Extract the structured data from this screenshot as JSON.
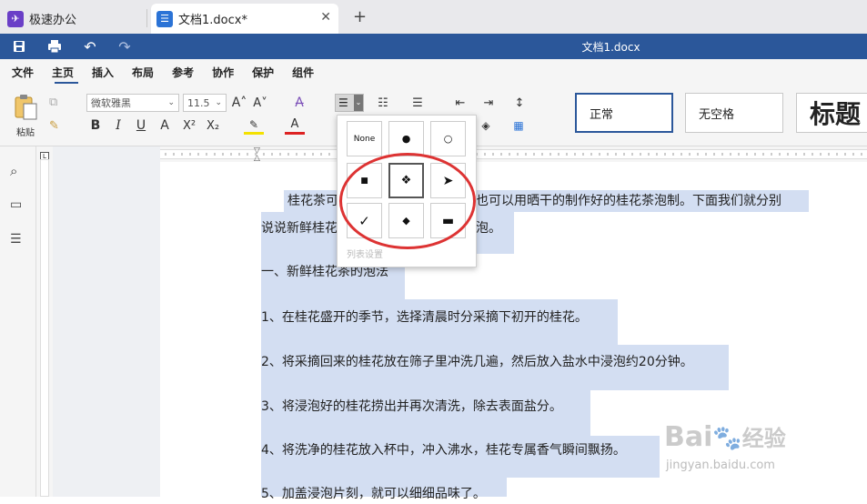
{
  "tabs": [
    {
      "label": "极速办公",
      "icon": "app-logo-icon"
    },
    {
      "label": "文档1.docx*",
      "icon": "document-icon"
    }
  ],
  "window": {
    "title": "文档1.docx"
  },
  "menu": [
    "文件",
    "主页",
    "插入",
    "布局",
    "参考",
    "协作",
    "保护",
    "组件"
  ],
  "ribbon": {
    "paste_label": "粘贴",
    "font_name": "微软雅黑",
    "font_size": "11.5",
    "bold": "B",
    "italic": "I",
    "underline": "U",
    "strike": "A",
    "superscript": "X²",
    "subscript": "X₂",
    "grow": "A˄",
    "shrink": "A˅"
  },
  "styles": [
    {
      "label": "正常"
    },
    {
      "label": "无空格"
    },
    {
      "label": "标题"
    }
  ],
  "bullet_popup": {
    "none_label": "None",
    "bullets": [
      "●",
      "○",
      "■",
      "❖",
      "➤",
      "✓",
      "◆",
      "▬"
    ],
    "settings_label": "列表设置"
  },
  "document": {
    "lines": [
      "桂花茶可",
      "也可以用晒干的制作好的桂花茶泡制。下面我们就分别",
      "说说新鲜桂花",
      "泡。",
      "一、新鲜桂花茶的泡法",
      "1、在桂花盛开的季节，选择清晨时分采摘下初开的桂花。",
      "2、将采摘回来的桂花放在筛子里冲洗几遍，然后放入盐水中浸泡约20分钟。",
      "3、将浸泡好的桂花捞出并再次清洗，除去表面盐分。",
      "4、将洗净的桂花放入杯中，冲入沸水，桂花专属香气瞬间飘扬。",
      "5、加盖浸泡片刻，就可以细细品味了。"
    ]
  },
  "watermark": {
    "brand": "Bai",
    "brand2": "经验",
    "url": "jingyan.baidu.com"
  },
  "colors": {
    "accent": "#2b579a",
    "selection": "#d3def2",
    "highlight_ring": "#dd3333"
  }
}
